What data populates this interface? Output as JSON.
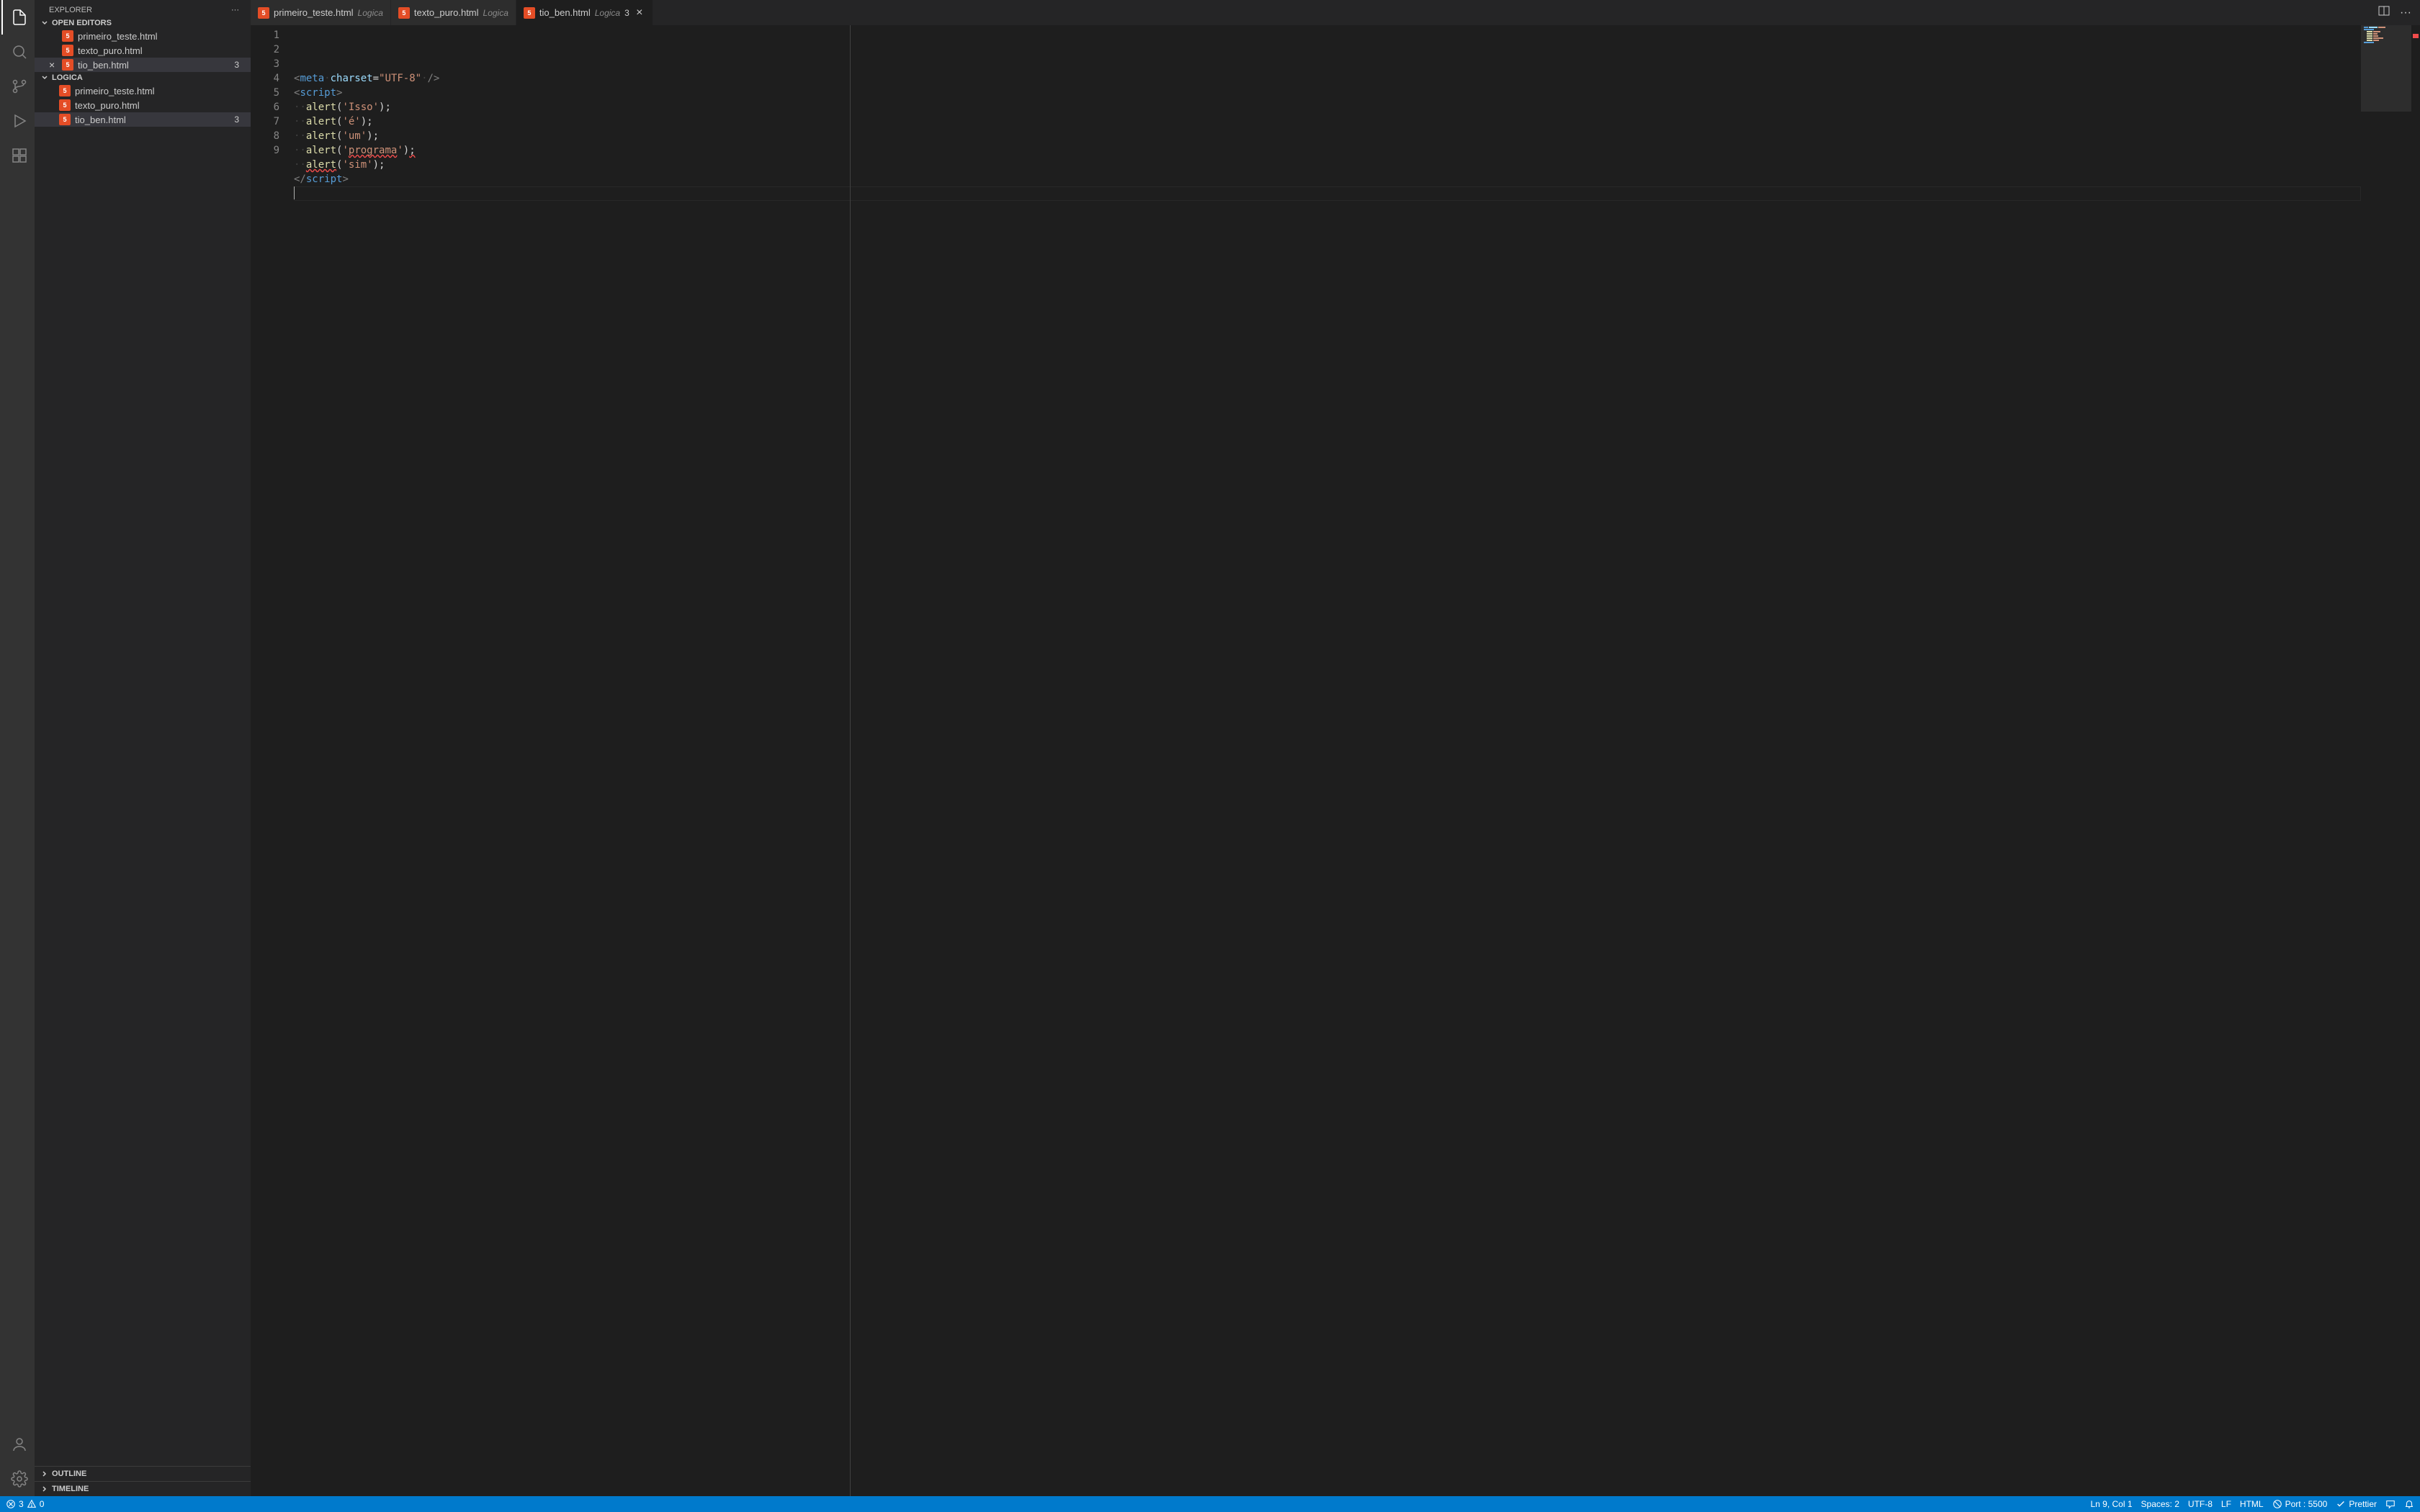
{
  "sidebar": {
    "title": "EXPLORER",
    "sections": {
      "open_editors": {
        "label": "OPEN EDITORS",
        "items": [
          {
            "name": "primeiro_teste.html",
            "badge": ""
          },
          {
            "name": "texto_puro.html",
            "badge": ""
          },
          {
            "name": "tio_ben.html",
            "badge": "3",
            "selected": true
          }
        ]
      },
      "folder": {
        "label": "LOGICA",
        "items": [
          {
            "name": "primeiro_teste.html",
            "badge": ""
          },
          {
            "name": "texto_puro.html",
            "badge": ""
          },
          {
            "name": "tio_ben.html",
            "badge": "3",
            "selected": true
          }
        ]
      },
      "outline": {
        "label": "OUTLINE"
      },
      "timeline": {
        "label": "TIMELINE"
      }
    }
  },
  "tabs": [
    {
      "name": "primeiro_teste.html",
      "desc": "Logica",
      "badge": "",
      "active": false
    },
    {
      "name": "texto_puro.html",
      "desc": "Logica",
      "badge": "",
      "active": false
    },
    {
      "name": "tio_ben.html",
      "desc": "Logica",
      "badge": "3",
      "active": true
    }
  ],
  "editor": {
    "lines": [
      {
        "n": "1",
        "html": "<span class='c-gray'>&lt;</span><span class='c-tag'>meta</span><span class='c-ws'>·</span><span class='c-attr'>charset</span><span class='c-pun'>=</span><span class='c-str'>\"UTF-8\"</span><span class='c-ws'>·</span><span class='c-gray'>/&gt;</span>"
      },
      {
        "n": "2",
        "html": "<span class='c-gray'>&lt;</span><span class='c-tag'>script</span><span class='c-gray'>&gt;</span>"
      },
      {
        "n": "3",
        "html": "<span class='c-ws'>··</span><span class='c-fn'>alert</span><span class='c-pun'>(</span><span class='c-str'>'Isso'</span><span class='c-pun'>);</span>"
      },
      {
        "n": "4",
        "html": "<span class='c-ws'>··</span><span class='c-fn'>alert</span><span class='c-pun'>(</span><span class='c-str'>'é'</span><span class='c-pun'>);</span>"
      },
      {
        "n": "5",
        "html": "<span class='c-ws'>··</span><span class='c-fn'>alert</span><span class='c-pun'>(</span><span class='c-str'>'um'</span><span class='c-pun'>);</span>"
      },
      {
        "n": "6",
        "html": "<span class='c-ws'>··</span><span class='c-fn'>alert</span><span class='c-pun'>(</span><span class='c-str'>'<span class='squiggle'>programa</span>'</span><span class='c-pun'>)<span class='squiggle'>;</span></span>"
      },
      {
        "n": "7",
        "html": "<span class='c-ws'>··</span><span class='c-fn squiggle'>alert</span><span class='c-pun'>(</span><span class='c-str'>'sim'</span><span class='c-pun'>);</span>"
      },
      {
        "n": "8",
        "html": "<span class='c-gray'>&lt;/</span><span class='c-tag'>script</span><span class='c-gray'>&gt;</span>"
      },
      {
        "n": "9",
        "html": "<span class='cursor-line'></span>",
        "current": true
      }
    ]
  },
  "status": {
    "errors": "3",
    "warnings": "0",
    "cursor": "Ln 9, Col 1",
    "spaces": "Spaces: 2",
    "encoding": "UTF-8",
    "eol": "LF",
    "lang": "HTML",
    "port": "Port : 5500",
    "prettier": "Prettier"
  }
}
